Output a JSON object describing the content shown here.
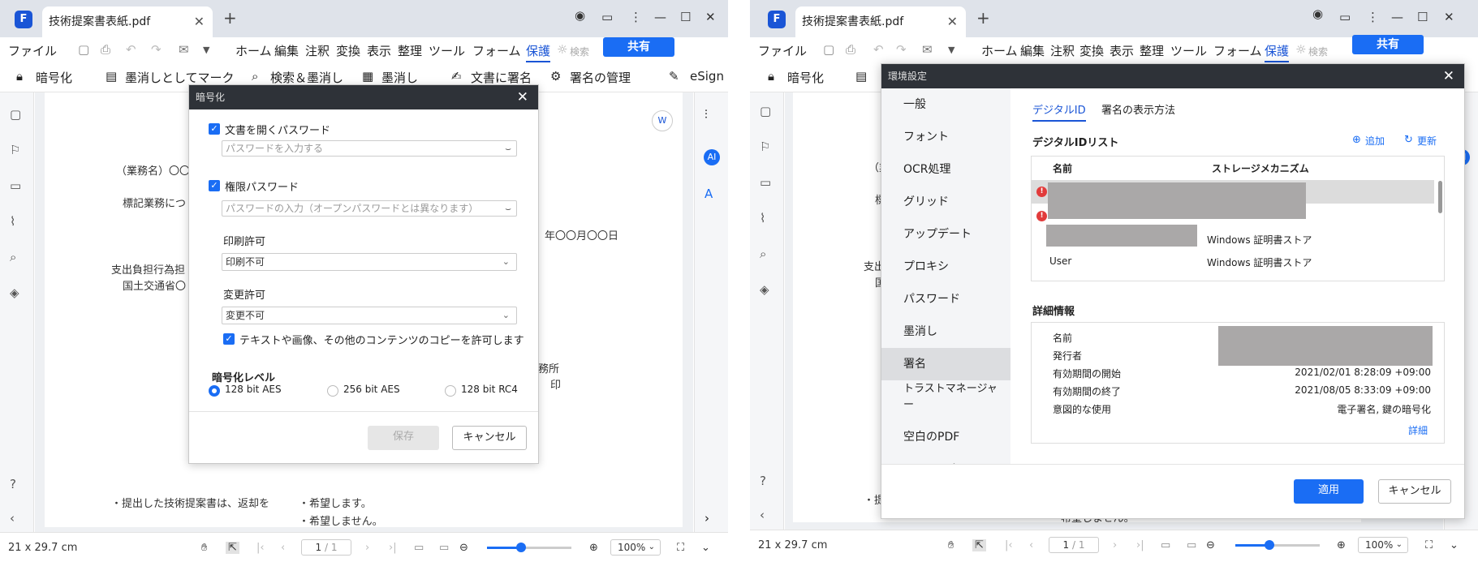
{
  "app": {
    "tab_title": "技術提案書表紙.pdf",
    "logo_letter": "F"
  },
  "menu": [
    "ファイル",
    "ホーム",
    "編集",
    "注釈",
    "変換",
    "表示",
    "整理",
    "ツール",
    "フォーム",
    "保護"
  ],
  "menu_tail": "検索",
  "share_label": "共有",
  "toolbar_left": {
    "encrypt": "暗号化",
    "mark_redact": "墨消しとしてマーク",
    "search_redact": "検索＆墨消し",
    "redact": "墨消し",
    "sign_doc": "文書に署名",
    "manage_sign": "署名の管理",
    "esign": "eSign"
  },
  "doc_text": {
    "line1": "（業務名）〇〇",
    "line2": "標記業務につ",
    "date": "年〇〇月〇〇日",
    "line3": "支出負担行為担",
    "line4": "国土交通省〇",
    "office": "務所",
    "seal": "印",
    "return_q": "・提出した技術提案書は、返却を",
    "opt1": "・希望します。",
    "opt2": "・希望しません。",
    "r_line1": "（業",
    "r_line2": "標",
    "r_line3": "支出",
    "r_line4": "国",
    "r_return": "・提",
    "r_opt2": "希望しません。"
  },
  "status": {
    "size": "21 x 29.7 cm",
    "page": "1",
    "total": "/ 1",
    "zoom": "100%",
    "zoom_r": "100%"
  },
  "encrypt_dialog": {
    "title": "暗号化",
    "open_pw_label": "文書を開くパスワード",
    "open_pw_placeholder": "パスワードを入力する",
    "perm_pw_label": "権限パスワード",
    "perm_pw_placeholder": "パスワードの入力（オープンパスワードとは異なります）",
    "print_label": "印刷許可",
    "print_value": "印刷不可",
    "change_label": "変更許可",
    "change_value": "変更不可",
    "copy_label": "テキストや画像、その他のコンテンツのコピーを許可します",
    "level_label": "暗号化レベル",
    "levels": [
      "128 bit AES",
      "256 bit AES",
      "128 bit RC4"
    ],
    "save": "保存",
    "cancel": "キャンセル"
  },
  "settings_dialog": {
    "title": "環境設定",
    "nav": [
      "一般",
      "フォント",
      "OCR処理",
      "グリッド",
      "アップデート",
      "プロキシ",
      "パスワード",
      "墨消し",
      "署名",
      "トラストマネージャ",
      "ー",
      "空白のPDF",
      "ショートカット"
    ],
    "tabs": [
      "デジタルID",
      "署名の表示方法"
    ],
    "list_title": "デジタルIDリスト",
    "add": "追加",
    "refresh": "更新",
    "col_name": "名前",
    "col_storage": "ストレージメカニズム",
    "rows": [
      {
        "name": "",
        "storage": ""
      },
      {
        "name": "",
        "storage": ""
      },
      {
        "name": "",
        "storage": "Windows 証明書ストア"
      },
      {
        "name": "User",
        "storage": "Windows 証明書ストア"
      }
    ],
    "details_title": "詳細情報",
    "details": [
      {
        "k": "名前",
        "v": ""
      },
      {
        "k": "発行者",
        "v": ""
      },
      {
        "k": "有効期間の開始",
        "v": "2021/02/01 8:28:09 +09:00"
      },
      {
        "k": "有効期間の終了",
        "v": "2021/08/05 8:33:09 +09:00"
      },
      {
        "k": "意図的な使用",
        "v": "電子署名, 鍵の暗号化"
      }
    ],
    "more": "詳細",
    "apply": "適用",
    "cancel": "キャンセル"
  },
  "colors": {
    "accent": "#1a6df4",
    "dialog_header": "#2e3238",
    "redaction": "#aaa8a8",
    "error": "#e23b3b"
  },
  "icons": [
    "hand-icon",
    "select-icon",
    "first-page-icon",
    "prev-page-icon",
    "next-page-icon",
    "last-page-icon",
    "zoom-out-icon",
    "zoom-in-icon",
    "fit-icon",
    "eye-icon",
    "ai-icon",
    "translate-icon"
  ]
}
